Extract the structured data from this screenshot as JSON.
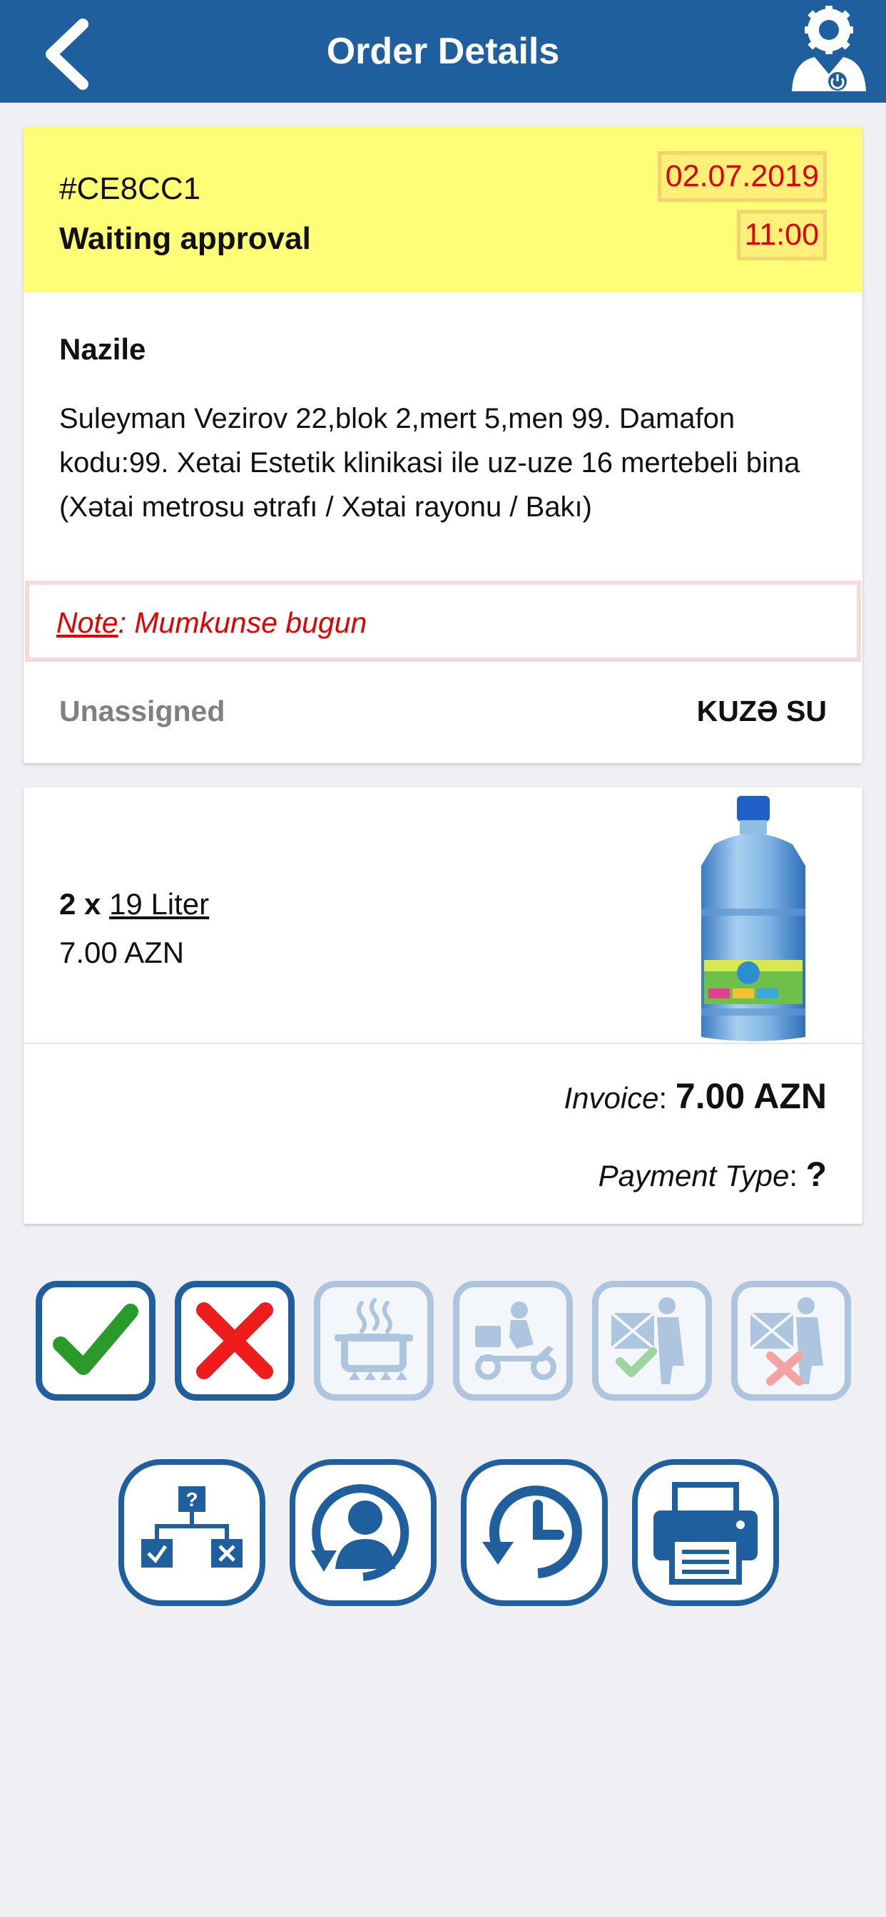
{
  "header": {
    "title": "Order Details",
    "back_icon": "chevron-left-icon",
    "profile_icon": "user-gear-icon"
  },
  "order": {
    "id": "#CE8CC1",
    "status": "Waiting approval",
    "date": "02.07.2019",
    "time": "11:00",
    "customer_name": "Nazile",
    "address": "Suleyman Vezirov 22,blok 2,mert 5,men 99. Damafon kodu:99. Xetai Estetik klinikasi ile uz-uze 16 mertebeli bina (Xətai metrosu ətrafı / Xətai rayonu / Bakı)",
    "note_label": "Note",
    "note_text": ": Mumkunse bugun",
    "assignment": "Unassigned",
    "supplier": "KUZƏ SU"
  },
  "product": {
    "quantity": "2 x",
    "name": "19 Liter",
    "price": "7.00 AZN"
  },
  "summary": {
    "invoice_label": "Invoice",
    "invoice_value": "7.00 AZN",
    "payment_label": "Payment Type",
    "payment_value": "?"
  },
  "status_actions": [
    {
      "name": "approve",
      "icon": "checkmark-icon",
      "enabled": true
    },
    {
      "name": "reject",
      "icon": "cross-icon",
      "enabled": true
    },
    {
      "name": "preparing",
      "icon": "cooking-pot-icon",
      "enabled": false
    },
    {
      "name": "delivering",
      "icon": "delivery-scooter-icon",
      "enabled": false
    },
    {
      "name": "delivered",
      "icon": "courier-check-icon",
      "enabled": false
    },
    {
      "name": "not-delivered",
      "icon": "courier-cross-icon",
      "enabled": false
    }
  ],
  "tool_actions": [
    {
      "name": "decision",
      "icon": "decision-tree-icon"
    },
    {
      "name": "reassign",
      "icon": "user-rotate-icon"
    },
    {
      "name": "history",
      "icon": "history-clock-icon"
    },
    {
      "name": "print",
      "icon": "printer-icon"
    }
  ],
  "colors": {
    "primary": "#1f5f9e",
    "disabled": "#aec5df",
    "highlight": "#ffff77",
    "alert_red": "#e20000",
    "success_green": "#2a9a2a"
  }
}
